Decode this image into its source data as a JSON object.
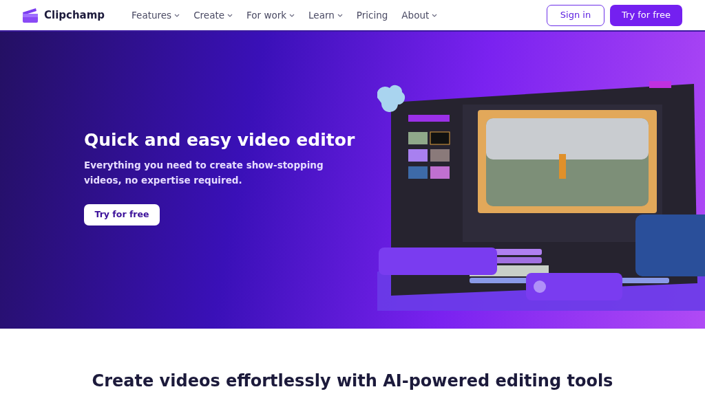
{
  "brand": {
    "name": "Clipchamp"
  },
  "nav": [
    {
      "label": "Features",
      "dropdown": true
    },
    {
      "label": "Create",
      "dropdown": true
    },
    {
      "label": "For work",
      "dropdown": true
    },
    {
      "label": "Learn",
      "dropdown": true
    },
    {
      "label": "Pricing",
      "dropdown": false
    },
    {
      "label": "About",
      "dropdown": true
    }
  ],
  "actions": [
    {
      "label": "Sign in",
      "kind": "outline"
    },
    {
      "label": "Try for free",
      "kind": "solid"
    }
  ],
  "hero": {
    "title": "Quick and easy video editor",
    "subtitle": "Everything you need to create show-stopping videos, no expertise required.",
    "button": "Try for free"
  },
  "section": {
    "heading": "Create videos effortlessly with AI-powered editing tools"
  }
}
